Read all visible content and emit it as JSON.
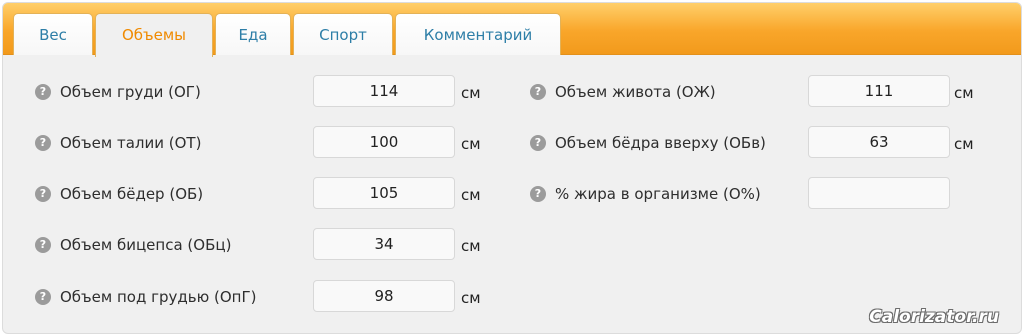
{
  "tabs": [
    {
      "label": "Вес",
      "active": false
    },
    {
      "label": "Объемы",
      "active": true
    },
    {
      "label": "Еда",
      "active": false
    },
    {
      "label": "Спорт",
      "active": false
    },
    {
      "label": "Комментарий",
      "active": false
    }
  ],
  "help_glyph": "?",
  "left_column": [
    {
      "label": "Объем груди (ОГ)",
      "value": "114",
      "unit": "см"
    },
    {
      "label": "Объем талии (ОТ)",
      "value": "100",
      "unit": "см"
    },
    {
      "label": "Объем бёдер (ОБ)",
      "value": "105",
      "unit": "см"
    },
    {
      "label": "Объем бицепса (ОБц)",
      "value": "34",
      "unit": "см"
    },
    {
      "label": "Объем под грудью (ОпГ)",
      "value": "98",
      "unit": "см"
    }
  ],
  "right_column": [
    {
      "label": "Объем живота (ОЖ)",
      "value": "111",
      "unit": "см"
    },
    {
      "label": "Объем бёдра вверху (ОБв)",
      "value": "63",
      "unit": "см"
    },
    {
      "label": "% жира в организме (О%)",
      "value": "",
      "unit": ""
    }
  ],
  "watermark": "Calorizator.ru",
  "colors": {
    "tabbar_orange": "#f9a62a",
    "active_tab_text": "#f08a00",
    "inactive_tab_text": "#2d7ea7",
    "panel_bg": "#f0f0f0"
  }
}
